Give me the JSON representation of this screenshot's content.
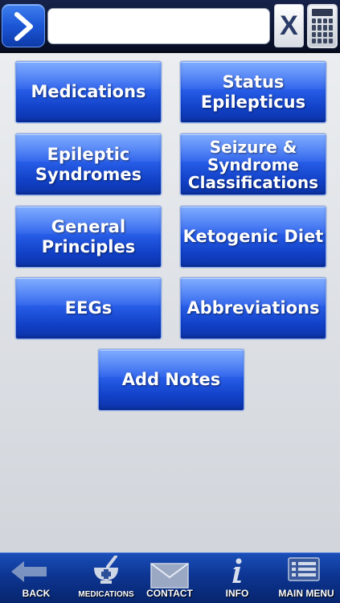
{
  "search": {
    "value": "",
    "placeholder": "",
    "clear_label": "X"
  },
  "icons": {
    "go": "chevron-right-icon",
    "calculator": "calculator-icon",
    "back": "back-arrow-icon",
    "medications": "mortar-pestle-icon",
    "contact": "envelope-icon",
    "info": "info-icon",
    "main_menu": "menu-list-icon"
  },
  "menu": {
    "medications": "Medications",
    "status_epilepticus": "Status\nEpilepticus",
    "epileptic_syndromes": "Epileptic\nSyndromes",
    "seizure_classifications": "Seizure &\nSyndrome\nClassifications",
    "general_principles": "General\nPrinciples",
    "ketogenic_diet": "Ketogenic Diet",
    "eegs": "EEGs",
    "abbreviations": "Abbreviations",
    "add_notes": "Add Notes"
  },
  "nav": {
    "back": "BACK",
    "medications": "MEDICATIONS",
    "contact": "CONTACT",
    "info": "INFO",
    "main_menu": "MAIN MENU"
  },
  "colors": {
    "button_blue": "#1c56d6",
    "topbar": "#0d1736",
    "bottombar": "#0d3592"
  }
}
